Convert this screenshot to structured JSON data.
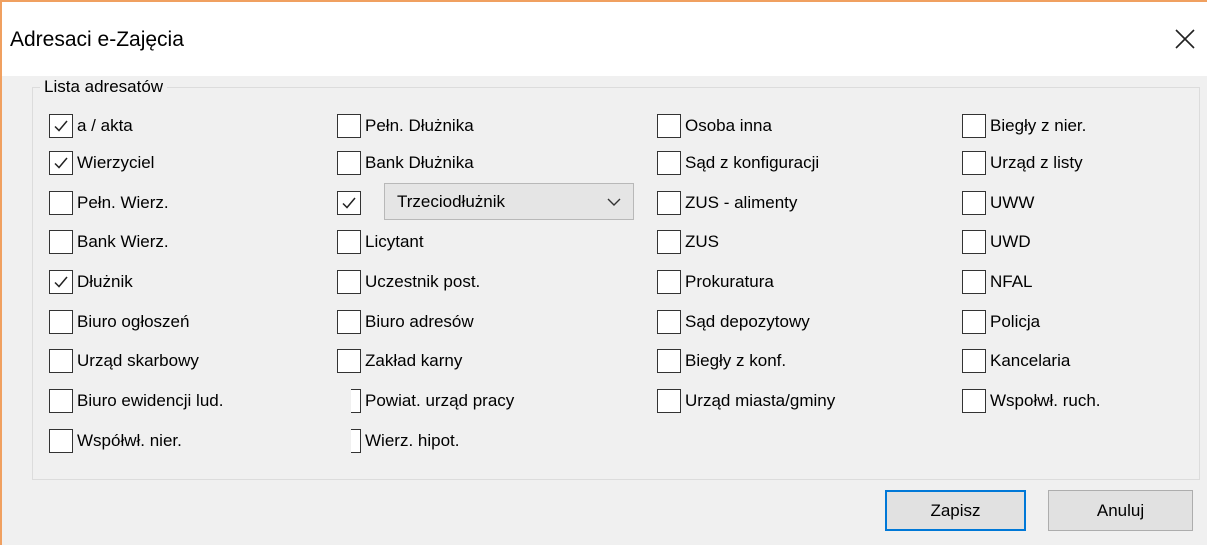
{
  "window": {
    "title": "Adresaci e-Zajęcia",
    "close_label": "close"
  },
  "group": {
    "label": "Lista adresatów"
  },
  "checkboxes": [
    {
      "label": "a / akta",
      "checked": true
    },
    {
      "label": "Wierzyciel",
      "checked": true
    },
    {
      "label": "Pełn. Wierz.",
      "checked": false
    },
    {
      "label": "Bank Wierz.",
      "checked": false
    },
    {
      "label": "Dłużnik",
      "checked": true
    },
    {
      "label": "Biuro ogłoszeń",
      "checked": false
    },
    {
      "label": "Urząd skarbowy",
      "checked": false
    },
    {
      "label": "Biuro ewidencji lud.",
      "checked": false
    },
    {
      "label": "Współwł. nier.",
      "checked": false
    },
    {
      "label": "Pełn. Dłużnika",
      "checked": false
    },
    {
      "label": "Bank Dłużnika",
      "checked": false
    },
    {
      "label": "",
      "checked": true
    },
    {
      "label": "Licytant",
      "checked": false
    },
    {
      "label": "Uczestnik post.",
      "checked": false
    },
    {
      "label": "Biuro adresów",
      "checked": false
    },
    {
      "label": "Zakład karny",
      "checked": false
    },
    {
      "label": "Powiat. urząd pracy",
      "checked": false
    },
    {
      "label": "Wierz. hipot.",
      "checked": false
    },
    {
      "label": "Osoba inna",
      "checked": false
    },
    {
      "label": "Sąd z konfiguracji",
      "checked": false
    },
    {
      "label": "ZUS  - alimenty",
      "checked": false
    },
    {
      "label": "ZUS",
      "checked": false
    },
    {
      "label": "Prokuratura",
      "checked": false
    },
    {
      "label": "Sąd depozytowy",
      "checked": false
    },
    {
      "label": "Biegły z konf.",
      "checked": false
    },
    {
      "label": "Urząd miasta/gminy",
      "checked": false
    },
    {
      "label": "Biegły z nier.",
      "checked": false
    },
    {
      "label": "Urząd z listy",
      "checked": false
    },
    {
      "label": "UWW",
      "checked": false
    },
    {
      "label": "UWD",
      "checked": false
    },
    {
      "label": "NFAL",
      "checked": false
    },
    {
      "label": "Policja",
      "checked": false
    },
    {
      "label": "Kancelaria",
      "checked": false
    },
    {
      "label": "Wspołwł. ruch.",
      "checked": false
    }
  ],
  "combo": {
    "value": "Trzeciodłużnik"
  },
  "buttons": {
    "save": "Zapisz",
    "cancel": "Anuluj"
  },
  "colors": {
    "accent": "#0078d7",
    "window_border": "#f0a060"
  }
}
